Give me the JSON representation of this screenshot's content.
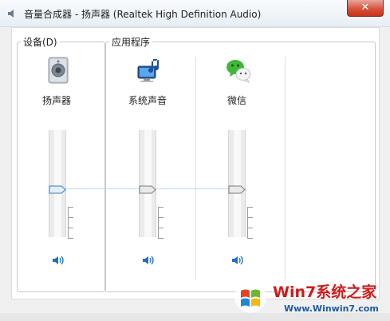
{
  "window": {
    "title": "音量合成器 - 扬声器 (Realtek High Definition Audio)",
    "close_glyph": "✕"
  },
  "groups": {
    "device": {
      "label": "设备(D)"
    },
    "apps": {
      "label": "应用程序"
    }
  },
  "channels": [
    {
      "label": "扬声器",
      "icon": "speaker-device-icon",
      "volume": 0.45,
      "muted": false
    },
    {
      "label": "系统声音",
      "icon": "system-sounds-icon",
      "volume": 0.45,
      "muted": false
    },
    {
      "label": "微信",
      "icon": "wechat-icon",
      "volume": 0.45,
      "muted": false
    }
  ],
  "watermark": {
    "brand": "Win7系统之家",
    "url": "Www.Winwin7.com"
  },
  "colors": {
    "accent": "#1e6fc8",
    "link_line": "#bcdcf0",
    "close": "#c8321b"
  }
}
